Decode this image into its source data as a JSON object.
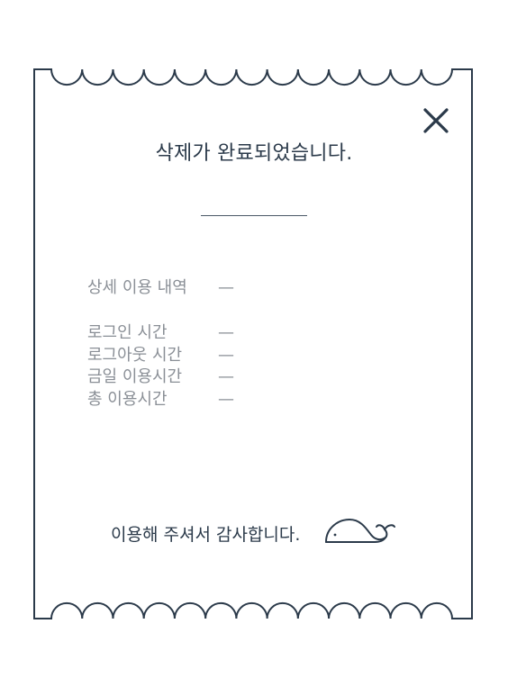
{
  "dialog": {
    "title": "삭제가 완료되었습니다.",
    "close_icon": "close-icon",
    "detail_heading_label": "상세 이용 내역",
    "detail_heading_value": "—",
    "details": [
      {
        "label": "로그인 시간",
        "value": "—"
      },
      {
        "label": "로그아웃 시간",
        "value": "—"
      },
      {
        "label": "금일 이용시간",
        "value": "—"
      },
      {
        "label": "총 이용시간",
        "value": "—"
      }
    ],
    "thanks_message": "이용해 주셔서 감사합니다.",
    "mascot_icon": "whale-icon"
  },
  "colors": {
    "frame": "#2b3a4a",
    "title_text": "#2b3a4a",
    "detail_text": "#8a8f96",
    "background": "#ffffff"
  }
}
